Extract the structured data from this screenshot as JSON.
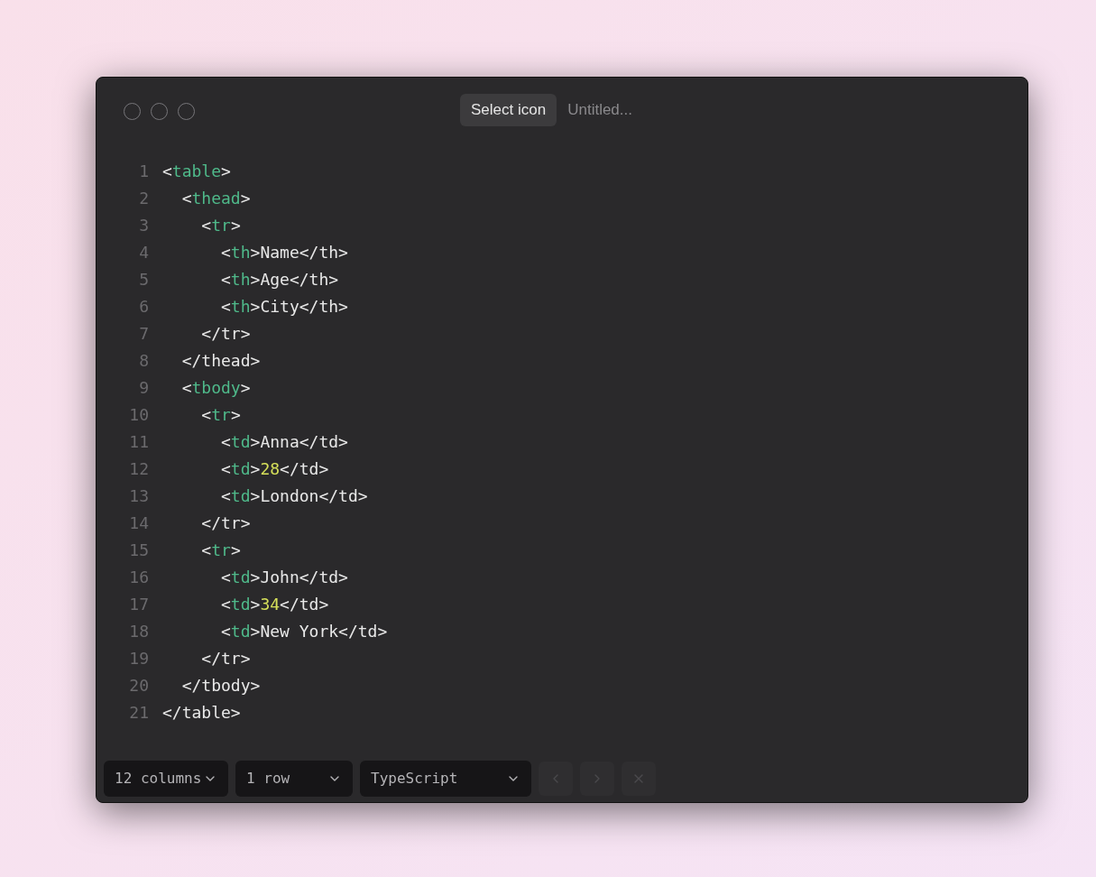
{
  "window": {
    "icon_button": "Select icon",
    "title": "Untitled..."
  },
  "code": [
    [
      {
        "kind": "punct",
        "text": "<"
      },
      {
        "kind": "tag",
        "text": "table"
      },
      {
        "kind": "punct",
        "text": ">"
      }
    ],
    [
      {
        "kind": "punct",
        "text": "  <"
      },
      {
        "kind": "tag",
        "text": "thead"
      },
      {
        "kind": "punct",
        "text": ">"
      }
    ],
    [
      {
        "kind": "punct",
        "text": "    <"
      },
      {
        "kind": "tag",
        "text": "tr"
      },
      {
        "kind": "punct",
        "text": ">"
      }
    ],
    [
      {
        "kind": "punct",
        "text": "      <"
      },
      {
        "kind": "tag",
        "text": "th"
      },
      {
        "kind": "punct",
        "text": ">Name</th>"
      }
    ],
    [
      {
        "kind": "punct",
        "text": "      <"
      },
      {
        "kind": "tag",
        "text": "th"
      },
      {
        "kind": "punct",
        "text": ">Age</th>"
      }
    ],
    [
      {
        "kind": "punct",
        "text": "      <"
      },
      {
        "kind": "tag",
        "text": "th"
      },
      {
        "kind": "punct",
        "text": ">City</th>"
      }
    ],
    [
      {
        "kind": "punct",
        "text": "    </tr>"
      }
    ],
    [
      {
        "kind": "punct",
        "text": "  </thead>"
      }
    ],
    [
      {
        "kind": "punct",
        "text": "  <"
      },
      {
        "kind": "tag",
        "text": "tbody"
      },
      {
        "kind": "punct",
        "text": ">"
      }
    ],
    [
      {
        "kind": "punct",
        "text": "    <"
      },
      {
        "kind": "tag",
        "text": "tr"
      },
      {
        "kind": "punct",
        "text": ">"
      }
    ],
    [
      {
        "kind": "punct",
        "text": "      <"
      },
      {
        "kind": "tag",
        "text": "td"
      },
      {
        "kind": "punct",
        "text": ">Anna</td>"
      }
    ],
    [
      {
        "kind": "punct",
        "text": "      <"
      },
      {
        "kind": "tag",
        "text": "td"
      },
      {
        "kind": "punct",
        "text": ">"
      },
      {
        "kind": "number",
        "text": "28"
      },
      {
        "kind": "punct",
        "text": "</td>"
      }
    ],
    [
      {
        "kind": "punct",
        "text": "      <"
      },
      {
        "kind": "tag",
        "text": "td"
      },
      {
        "kind": "punct",
        "text": ">London</td>"
      }
    ],
    [
      {
        "kind": "punct",
        "text": "    </tr>"
      }
    ],
    [
      {
        "kind": "punct",
        "text": "    <"
      },
      {
        "kind": "tag",
        "text": "tr"
      },
      {
        "kind": "punct",
        "text": ">"
      }
    ],
    [
      {
        "kind": "punct",
        "text": "      <"
      },
      {
        "kind": "tag",
        "text": "td"
      },
      {
        "kind": "punct",
        "text": ">John</td>"
      }
    ],
    [
      {
        "kind": "punct",
        "text": "      <"
      },
      {
        "kind": "tag",
        "text": "td"
      },
      {
        "kind": "punct",
        "text": ">"
      },
      {
        "kind": "number",
        "text": "34"
      },
      {
        "kind": "punct",
        "text": "</td>"
      }
    ],
    [
      {
        "kind": "punct",
        "text": "      <"
      },
      {
        "kind": "tag",
        "text": "td"
      },
      {
        "kind": "punct",
        "text": ">New York</td>"
      }
    ],
    [
      {
        "kind": "punct",
        "text": "    </tr>"
      }
    ],
    [
      {
        "kind": "punct",
        "text": "  </tbody>"
      }
    ],
    [
      {
        "kind": "punct",
        "text": "</table>"
      }
    ]
  ],
  "line_numbers": [
    "1",
    "2",
    "3",
    "4",
    "5",
    "6",
    "7",
    "8",
    "9",
    "10",
    "11",
    "12",
    "13",
    "14",
    "15",
    "16",
    "17",
    "18",
    "19",
    "20",
    "21"
  ],
  "toolbar": {
    "selects": [
      {
        "value": "12 columns"
      },
      {
        "value": "1 row"
      },
      {
        "value": "TypeScript"
      }
    ],
    "buttons": [
      {
        "kind": "prev",
        "disabled": true
      },
      {
        "kind": "next",
        "disabled": true
      },
      {
        "kind": "close",
        "disabled": true
      }
    ]
  }
}
